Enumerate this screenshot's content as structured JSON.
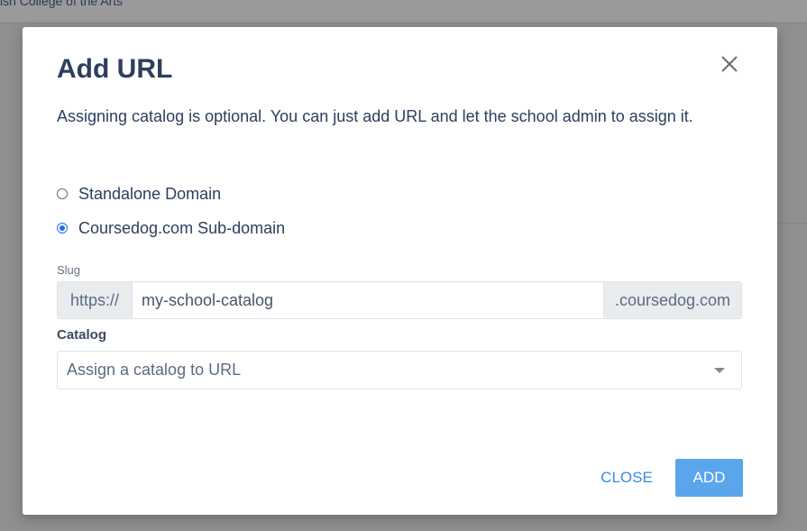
{
  "background": {
    "header_text": "ish College of the Arts"
  },
  "dialog": {
    "title": "Add URL",
    "description": "Assigning catalog is optional. You can just add URL and let the school admin to assign it.",
    "options": [
      {
        "label": "Standalone Domain",
        "checked": false
      },
      {
        "label": "Coursedog.com Sub-domain",
        "checked": true
      }
    ],
    "slug": {
      "label": "Slug",
      "prefix": "https://",
      "value": "my-school-catalog",
      "suffix": ".coursedog.com"
    },
    "catalog": {
      "label": "Catalog",
      "placeholder": "Assign a catalog to URL"
    },
    "buttons": {
      "close": "CLOSE",
      "add": "ADD"
    }
  },
  "colors": {
    "accent": "#3a8be0",
    "add_button": "#5aa6ec",
    "title": "#2d3e5e"
  }
}
